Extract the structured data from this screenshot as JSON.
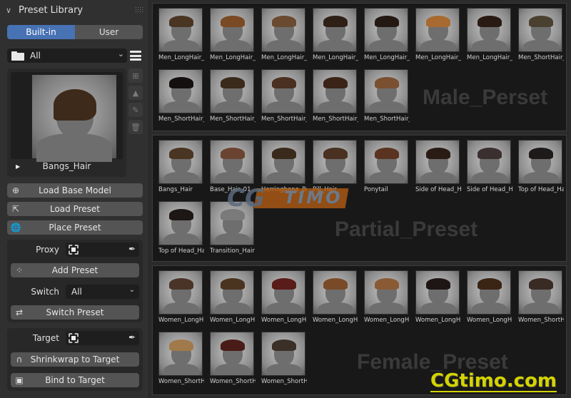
{
  "panel": {
    "title": "Preset Library",
    "tabs": [
      {
        "label": "Built-in",
        "active": true
      },
      {
        "label": "User",
        "active": false
      }
    ],
    "category": "All",
    "selected_preset": "Bangs_Hair",
    "side_icons": [
      "add-preset-icon",
      "image-icon",
      "pencil-icon",
      "trash-icon"
    ],
    "buttons": {
      "load_base_model": "Load Base Model",
      "load_preset": "Load Preset",
      "place_preset": "Place Preset",
      "add_preset": "Add Preset",
      "switch_preset": "Switch Preset",
      "shrinkwrap": "Shrinkwrap to Target",
      "bind": "Bind to Target"
    },
    "proxy_label": "Proxy",
    "switch_label": "Switch",
    "switch_value": "All",
    "target_label": "Target"
  },
  "sections": [
    {
      "watermark": "Male_Perset",
      "items": [
        "Men_LongHair_...",
        "Men_LongHair_...",
        "Men_LongHair_...",
        "Men_LongHair_...",
        "Men_LongHair_...",
        "Men_LongHair_...",
        "Men_LongHair_...",
        "Men_ShortHair_...",
        "Men_ShortHair_...",
        "Men_ShortHair_...",
        "Men_ShortHair_...",
        "Men_ShortHair_...",
        "Men_ShortHair_..."
      ],
      "hair_colors": [
        "#4a3422",
        "#7a4a24",
        "#6a4a30",
        "#2e2016",
        "#241812",
        "#a86a30",
        "#2a1a14",
        "#4a4030",
        "#141010",
        "#3a2a1c",
        "#4a3020",
        "#3a2418",
        "#7a5030"
      ]
    },
    {
      "watermark": "Partial_Preset",
      "items": [
        "Bangs_Hair",
        "Base_Hair_01",
        "Herringbone_Br...",
        "Pill_Hair",
        "Ponytail",
        "Side of Head_H...",
        "Side of Head_H...",
        "Top of Head_Ha...",
        "Top of Head_Ha...",
        "Transition_Hair"
      ],
      "hair_colors": [
        "#4a3422",
        "#6a4430",
        "#3a2a1c",
        "#4a3020",
        "#5a3420",
        "#2a1c14",
        "#3a3030",
        "#1e1a1a",
        "#1c1614",
        "#7a7a7a"
      ]
    },
    {
      "watermark": "Female_Preset",
      "items": [
        "Women_LongH...",
        "Women_LongH...",
        "Women_LongH...",
        "Women_LongH...",
        "Women_LongH...",
        "Women_LongH...",
        "Women_LongH...",
        "Women_ShortH...",
        "Women_ShortH...",
        "Women_ShortH...",
        "Women_ShortH..."
      ],
      "hair_colors": [
        "#4a3428",
        "#4a3420",
        "#5a1c18",
        "#7a4a28",
        "#8a5a34",
        "#1e1614",
        "#3a2414",
        "#3a2a24",
        "#a07a4a",
        "#4a1c18",
        "#3a3028"
      ]
    }
  ],
  "watermarks": {
    "logo_cg": "CG",
    "logo_timo": "TIMO",
    "site": "CGtimo.com"
  }
}
